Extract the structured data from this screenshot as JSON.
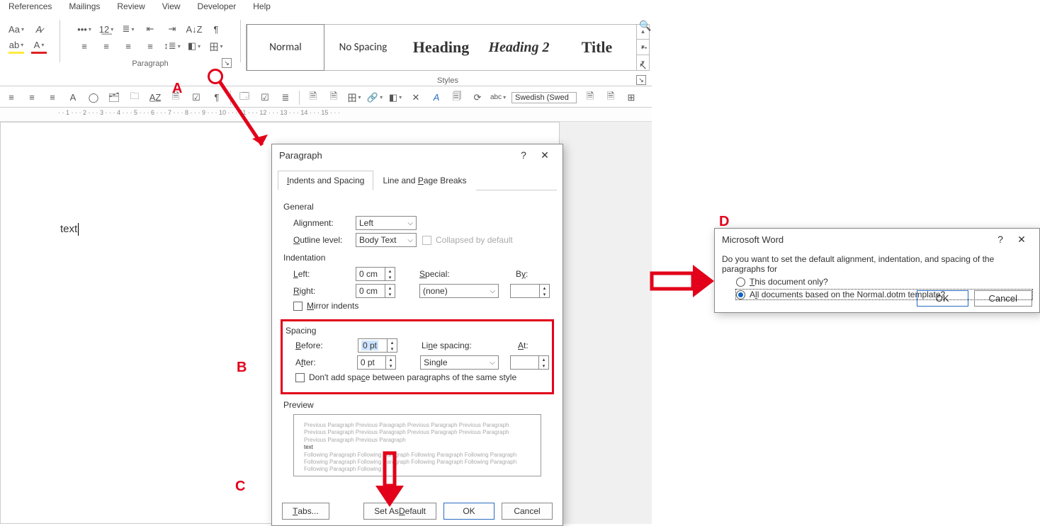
{
  "menu": {
    "items": [
      "References",
      "Mailings",
      "Review",
      "View",
      "Developer",
      "Help"
    ]
  },
  "ribbon": {
    "paragraph_label": "Paragraph",
    "styles_label": "Styles",
    "styles": [
      {
        "key": "normal",
        "label": "Normal"
      },
      {
        "key": "nospace",
        "label": "No Spacing"
      },
      {
        "key": "h1",
        "label": "Heading"
      },
      {
        "key": "h2",
        "label": "Heading 2"
      },
      {
        "key": "title",
        "label": "Title"
      }
    ]
  },
  "qat2": {
    "language_value": "Swedish (Swed"
  },
  "document": {
    "text": "text"
  },
  "dlg_paragraph": {
    "title": "Paragraph",
    "tab_indents": "Indents and Spacing",
    "tab_breaks": "Line and Page Breaks",
    "general_hdr": "General",
    "alignment_label": "Alignment:",
    "alignment_value": "Left",
    "outline_label": "Outline level:",
    "outline_value": "Body Text",
    "collapsed_label": "Collapsed by default",
    "indent_hdr": "Indentation",
    "left_label": "Left:",
    "left_value": "0 cm",
    "right_label": "Right:",
    "right_value": "0 cm",
    "special_label": "Special:",
    "special_value": "(none)",
    "by_label": "By:",
    "by_value": "",
    "mirror_label": "Mirror indents",
    "spacing_hdr": "Spacing",
    "before_label": "Before:",
    "before_value": "0 pt",
    "after_label": "After:",
    "after_value": "0 pt",
    "linespacing_label": "Line spacing:",
    "linespacing_value": "Single",
    "at_label": "At:",
    "at_value": "",
    "dontadd_label": "Don't add space between paragraphs of the same style",
    "preview_hdr": "Preview",
    "preview_prev": "Previous Paragraph Previous Paragraph Previous Paragraph Previous Paragraph Previous Paragraph Previous Paragraph Previous Paragraph Previous Paragraph Previous Paragraph Previous Paragraph",
    "preview_sample": "text",
    "preview_next": "Following Paragraph Following Paragraph Following Paragraph Following Paragraph Following Paragraph Following Paragraph Following Paragraph Following Paragraph Following Paragraph Following",
    "btn_tabs": "Tabs...",
    "btn_setdefault": "Set As Default",
    "btn_ok": "OK",
    "btn_cancel": "Cancel"
  },
  "dlg_confirm": {
    "title": "Microsoft Word",
    "question": "Do you want to set the default alignment, indentation, and spacing of the paragraphs for",
    "opt_this": "This document only?",
    "opt_all": "All documents based on the Normal.dotm template?",
    "btn_ok": "OK",
    "btn_cancel": "Cancel"
  },
  "annotations": {
    "A": "A",
    "B": "B",
    "C": "C",
    "D": "D"
  },
  "ruler_text": "· · 1 · · · 2 · · · 3 · · · 4 · · · 5 · · · 6 · · · 7 · · · 8 · · · 9 · · · 10 · · · 11 · · · 12 · · · 13 · · · 14 · · · 15 · · ·"
}
